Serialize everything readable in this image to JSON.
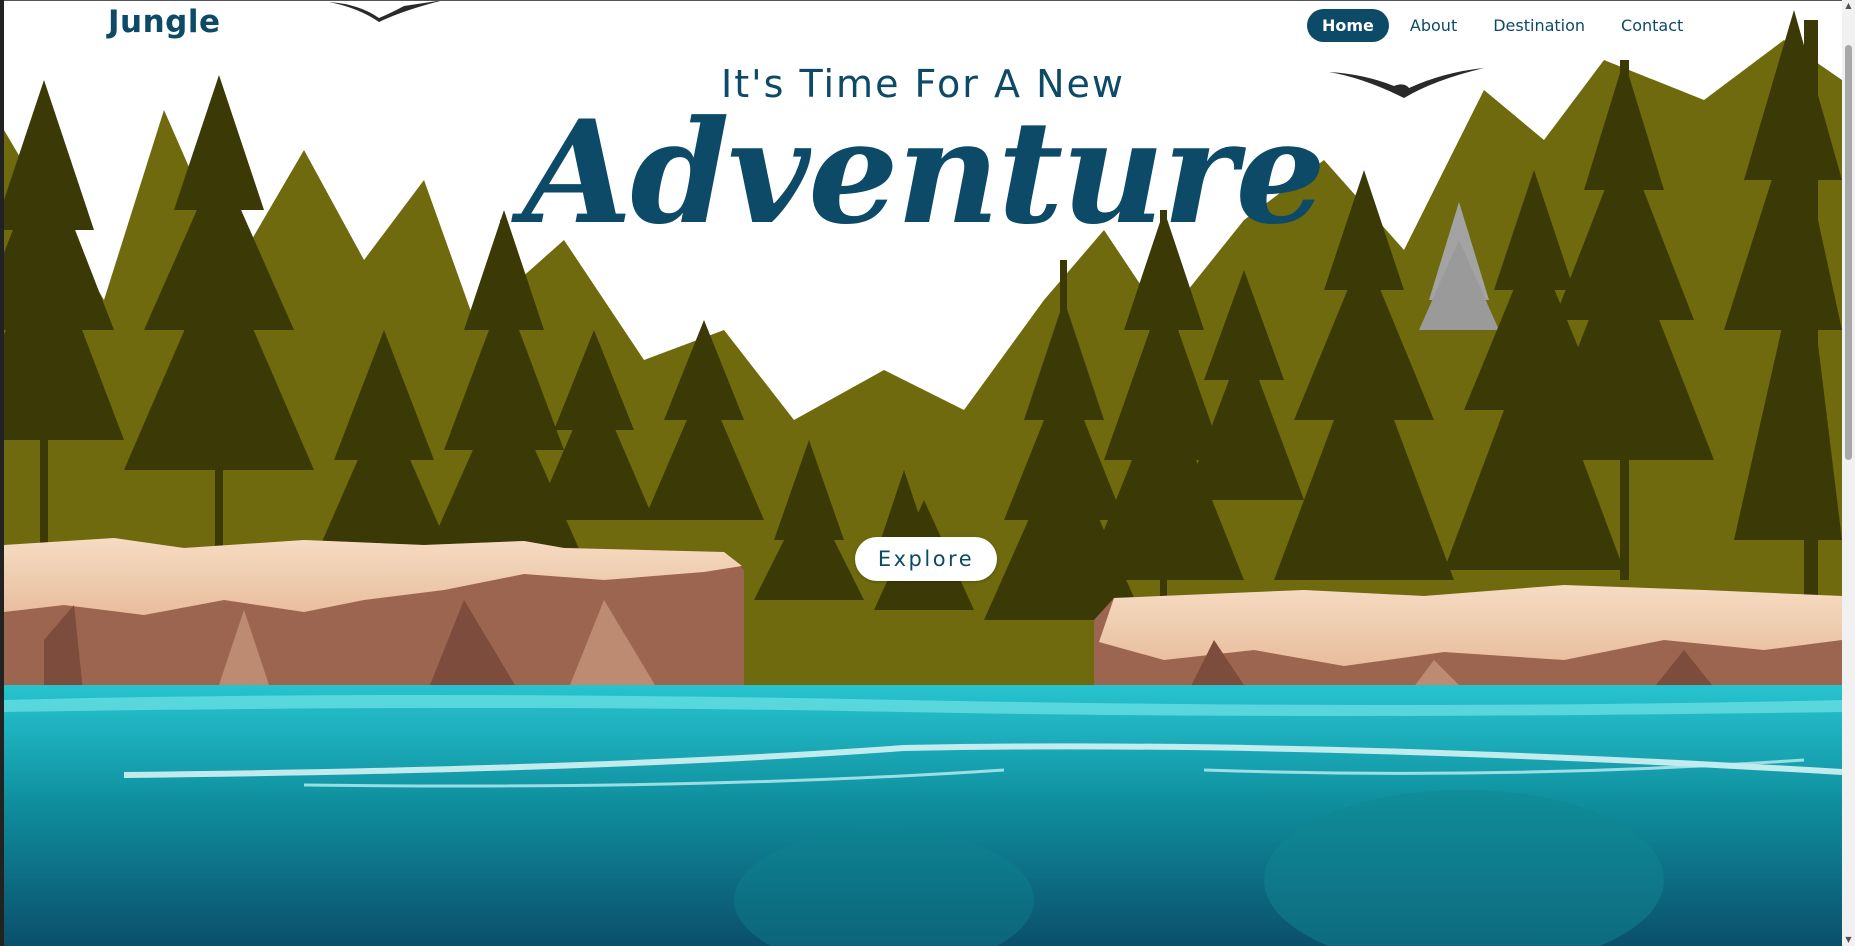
{
  "brand": {
    "logo": "Jungle"
  },
  "nav": {
    "items": [
      {
        "label": "Home",
        "active": true
      },
      {
        "label": "About",
        "active": false
      },
      {
        "label": "Destination",
        "active": false
      },
      {
        "label": "Contact",
        "active": false
      }
    ]
  },
  "hero": {
    "tagline": "It's Time For A New",
    "headline": "Adventure",
    "cta_label": "Explore"
  },
  "icons": {
    "scroll_up": "chevron-up-icon",
    "scroll_down": "chevron-down-icon",
    "bird": "bird-icon"
  },
  "colors": {
    "brand": "#0c4a68",
    "forest_light": "#6e6a0d",
    "forest_dark": "#3b3a06",
    "cliff": "#a86e55",
    "water": "#13a7b3",
    "water_deep": "#0b4f6c"
  }
}
